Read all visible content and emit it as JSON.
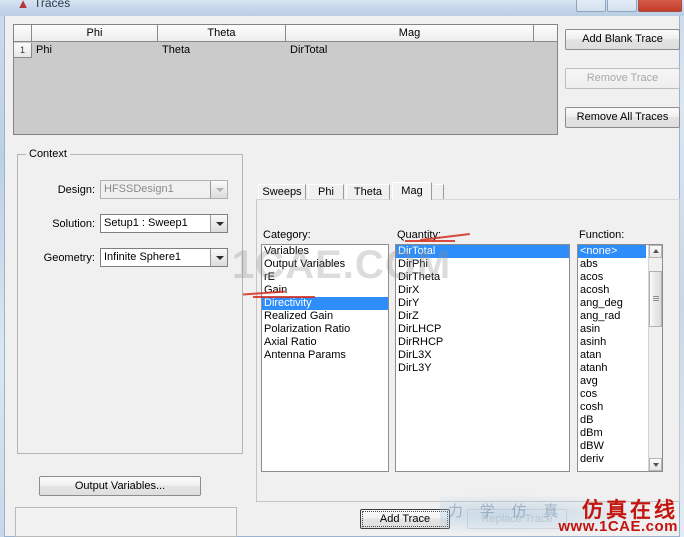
{
  "window": {
    "title": "Traces",
    "icon": "ansys-logo-icon",
    "controls": [
      "minimize",
      "maximize",
      "close"
    ]
  },
  "traces_grid": {
    "columns": [
      "",
      "Phi",
      "Theta",
      "Mag",
      ""
    ],
    "rows": [
      {
        "num": "1",
        "phi": "Phi",
        "theta": "Theta",
        "mag": "DirTotal"
      }
    ]
  },
  "trace_buttons": {
    "add_blank": "Add Blank Trace",
    "remove": "Remove Trace",
    "remove_all": "Remove All Traces"
  },
  "context": {
    "legend": "Context",
    "design_label": "Design:",
    "design_value": "HFSSDesign1",
    "solution_label": "Solution:",
    "solution_value": "Setup1 : Sweep1",
    "geometry_label": "Geometry:",
    "geometry_value": "Infinite Sphere1"
  },
  "output_variables_button": "Output Variables...",
  "tabs": [
    {
      "label": "Sweeps",
      "active": false
    },
    {
      "label": "Phi",
      "active": false
    },
    {
      "label": "Theta",
      "active": false
    },
    {
      "label": "Mag",
      "active": true
    }
  ],
  "category": {
    "label": "Category:",
    "items": [
      "Variables",
      "Output Variables",
      "rE",
      "Gain",
      "Directivity",
      "Realized Gain",
      "Polarization Ratio",
      "Axial Ratio",
      "Antenna Params"
    ],
    "selected": "Directivity"
  },
  "quantity": {
    "label": "Quantity:",
    "items": [
      "DirTotal",
      "DirPhi",
      "DirTheta",
      "DirX",
      "DirY",
      "DirZ",
      "DirLHCP",
      "DirRHCP",
      "DirL3X",
      "DirL3Y"
    ],
    "selected": "DirTotal"
  },
  "function": {
    "label": "Function:",
    "items": [
      "<none>",
      "abs",
      "acos",
      "acosh",
      "ang_deg",
      "ang_rad",
      "asin",
      "asinh",
      "atan",
      "atanh",
      "avg",
      "cos",
      "cosh",
      "dB",
      "dBm",
      "dBW",
      "deriv"
    ],
    "selected": "<none>"
  },
  "action_buttons": {
    "add_trace": "Add Trace",
    "replace_trace": "Replace Trace"
  },
  "watermarks": {
    "center": "1CAE.COM",
    "brand_cn": "仿真在线",
    "brand_url": "www.1CAE.com",
    "ghost_cn": "力 学 仿 真"
  },
  "colors": {
    "selection_blue": "#2d8dfb",
    "annotation_red": "#d42b1f",
    "brand_red": "#c3140d",
    "dialog_face": "#f0f0f0",
    "grid_face": "#cbcbcb"
  }
}
